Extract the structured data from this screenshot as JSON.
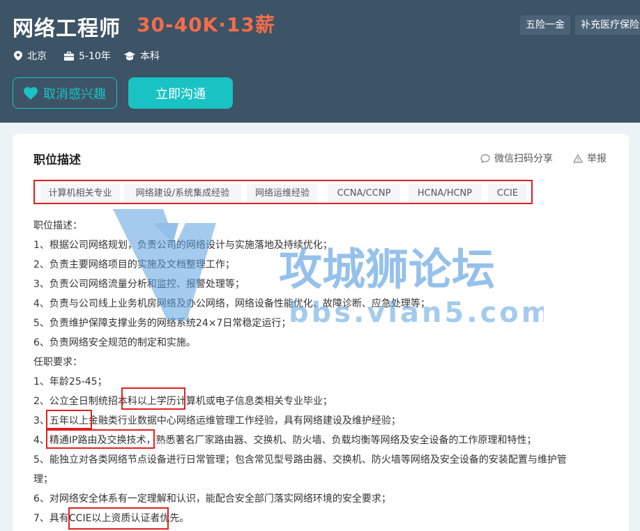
{
  "job": {
    "title": "网络工程师",
    "salary": "30-40K·13薪",
    "benefits": [
      "五险一金",
      "补充医疗保险"
    ],
    "location": "北京",
    "experience": "5-10年",
    "education": "本科"
  },
  "buttons": {
    "unfavorite": "取消感兴趣",
    "chat": "立即沟通"
  },
  "section": {
    "title": "职位描述",
    "share": "微信扫码分享",
    "report": "举报"
  },
  "tags": [
    "计算机相关专业",
    "网络建设/系统集成经验",
    "网络运维经验",
    "CCNA/CCNP",
    "HCNA/HCNP",
    "CCIE"
  ],
  "description": [
    "职位描述：",
    "1、根据公司网络规划，负责公司的网络设计与实施落地及持续优化；",
    "2、负责主要网络项目的实施及文档整理工作；",
    "3、负责公司网络流量分析和监控、报警处理等；",
    "4、负责与公司线上业务机房网络及办公网络，网络设备性能优化、故障诊断、应急处理等；",
    "5、负责维护保障支撑业务的网络系统24×7日常稳定运行；",
    "6、负责网络安全规范的制定和实施。",
    "任职要求：",
    "1、年龄25-45；",
    "2、公立全日制统招本科以上学历计算机或电子信息类相关专业毕业；",
    "3、五年以上金融类行业数据中心网络运维管理工作经验，具有网络建设及维护经验；",
    "4、精通IP路由及交换技术，熟悉著名厂家路由器、交换机、防火墙、负载均衡等网络及安全设备的工作原理和特性；",
    "5、能独立对各类网络节点设备进行日常管理；包含常见型号路由器、交换机、防火墙等网络及安全设备的安装配置与维护管",
    "理；",
    "6、对网络安全体系有一定理解和认识，能配合安全部门落实网络环境的安全要求；",
    "7、具有CCIE以上资质认证者优先。"
  ],
  "watermark": {
    "brand": "攻城狮论坛",
    "url": "bbs.vlan5.com"
  },
  "colors": {
    "header_bg": "#3d5366",
    "accent": "#19c3c3",
    "salary": "#f26d4a",
    "highlight": "#e0201f"
  }
}
